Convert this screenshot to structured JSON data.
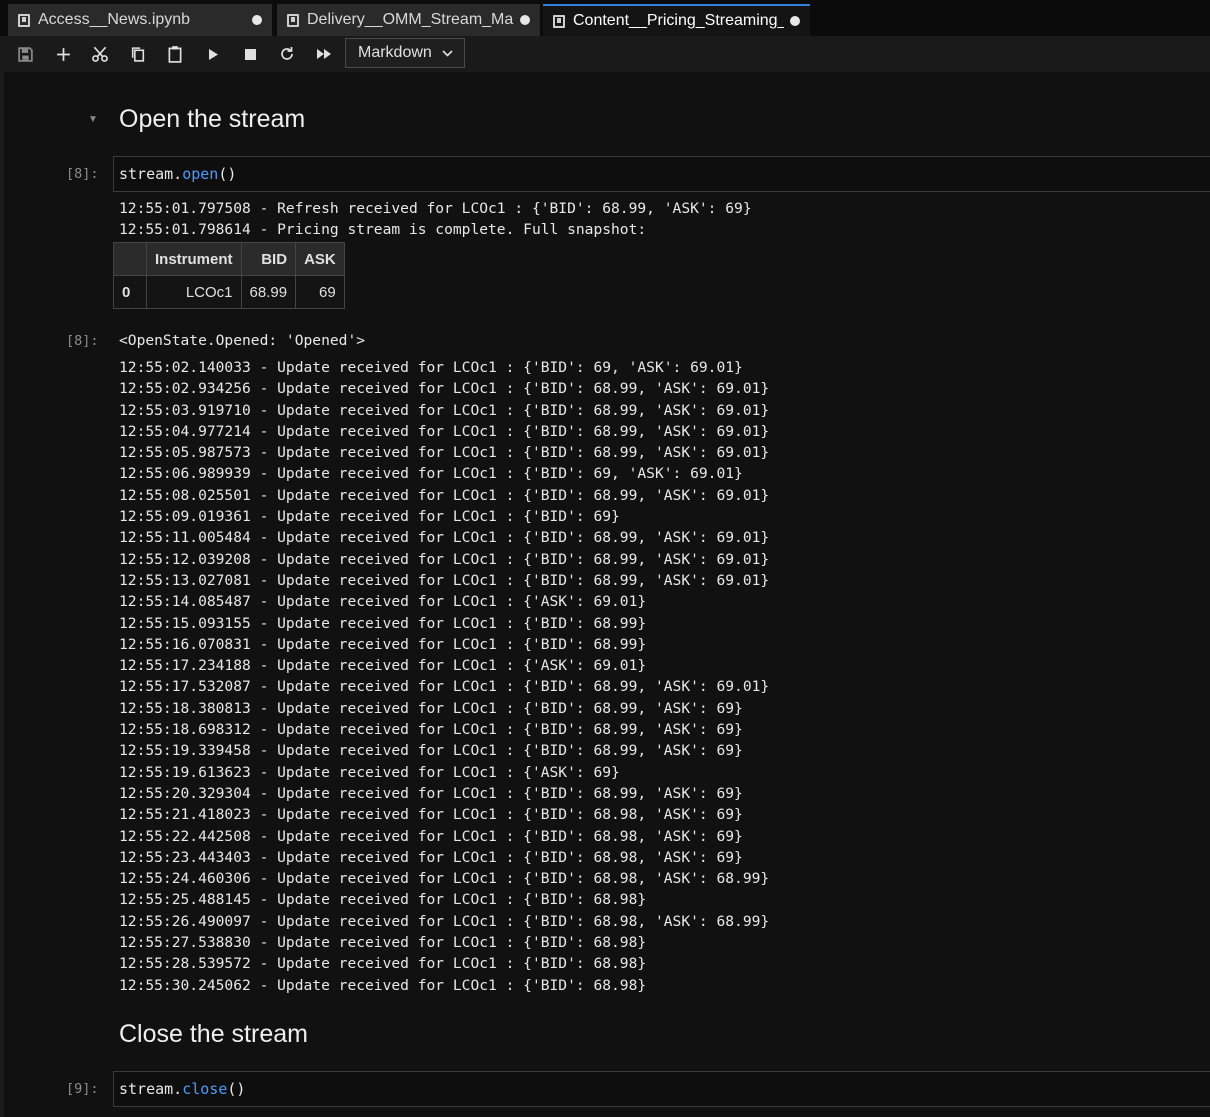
{
  "tabs": [
    {
      "label": "Access__News.ipynb",
      "active": false
    },
    {
      "label": "Delivery__OMM_Stream_Marl",
      "active": false
    },
    {
      "label": "Content__Pricing_Streaming_",
      "active": true
    }
  ],
  "toolbar": {
    "icons": [
      "save-icon",
      "add-cell-icon",
      "cut-icon",
      "copy-icon",
      "paste-icon",
      "run-icon",
      "stop-icon",
      "restart-icon",
      "fast-forward-icon"
    ],
    "cell_type": "Markdown"
  },
  "cells": {
    "heading_open": "Open the stream",
    "prompt_open": "[8]:",
    "code_open_obj": "stream.",
    "code_open_fn": "open",
    "code_open_rest": "()",
    "refresh_line": "12:55:01.797508 - Refresh received for LCOc1 : {'BID': 68.99, 'ASK': 69}",
    "complete_line": "12:55:01.798614 - Pricing stream is complete. Full snapshot:",
    "df": {
      "columns": [
        "",
        "Instrument",
        "BID",
        "ASK"
      ],
      "row_index": "0",
      "row": [
        "LCOc1",
        "68.99",
        "69"
      ]
    },
    "prompt_out": "[8]:",
    "open_state": "<OpenState.Opened: 'Opened'>",
    "updates": [
      "12:55:02.140033 - Update received for LCOc1 : {'BID': 69, 'ASK': 69.01}",
      "12:55:02.934256 - Update received for LCOc1 : {'BID': 68.99, 'ASK': 69.01}",
      "12:55:03.919710 - Update received for LCOc1 : {'BID': 68.99, 'ASK': 69.01}",
      "12:55:04.977214 - Update received for LCOc1 : {'BID': 68.99, 'ASK': 69.01}",
      "12:55:05.987573 - Update received for LCOc1 : {'BID': 68.99, 'ASK': 69.01}",
      "12:55:06.989939 - Update received for LCOc1 : {'BID': 69, 'ASK': 69.01}",
      "12:55:08.025501 - Update received for LCOc1 : {'BID': 68.99, 'ASK': 69.01}",
      "12:55:09.019361 - Update received for LCOc1 : {'BID': 69}",
      "12:55:11.005484 - Update received for LCOc1 : {'BID': 68.99, 'ASK': 69.01}",
      "12:55:12.039208 - Update received for LCOc1 : {'BID': 68.99, 'ASK': 69.01}",
      "12:55:13.027081 - Update received for LCOc1 : {'BID': 68.99, 'ASK': 69.01}",
      "12:55:14.085487 - Update received for LCOc1 : {'ASK': 69.01}",
      "12:55:15.093155 - Update received for LCOc1 : {'BID': 68.99}",
      "12:55:16.070831 - Update received for LCOc1 : {'BID': 68.99}",
      "12:55:17.234188 - Update received for LCOc1 : {'ASK': 69.01}",
      "12:55:17.532087 - Update received for LCOc1 : {'BID': 68.99, 'ASK': 69.01}",
      "12:55:18.380813 - Update received for LCOc1 : {'BID': 68.99, 'ASK': 69}",
      "12:55:18.698312 - Update received for LCOc1 : {'BID': 68.99, 'ASK': 69}",
      "12:55:19.339458 - Update received for LCOc1 : {'BID': 68.99, 'ASK': 69}",
      "12:55:19.613623 - Update received for LCOc1 : {'ASK': 69}",
      "12:55:20.329304 - Update received for LCOc1 : {'BID': 68.99, 'ASK': 69}",
      "12:55:21.418023 - Update received for LCOc1 : {'BID': 68.98, 'ASK': 69}",
      "12:55:22.442508 - Update received for LCOc1 : {'BID': 68.98, 'ASK': 69}",
      "12:55:23.443403 - Update received for LCOc1 : {'BID': 68.98, 'ASK': 69}",
      "12:55:24.460306 - Update received for LCOc1 : {'BID': 68.98, 'ASK': 68.99}",
      "12:55:25.488145 - Update received for LCOc1 : {'BID': 68.98}",
      "12:55:26.490097 - Update received for LCOc1 : {'BID': 68.98, 'ASK': 68.99}",
      "12:55:27.538830 - Update received for LCOc1 : {'BID': 68.98}",
      "12:55:28.539572 - Update received for LCOc1 : {'BID': 68.98}",
      "12:55:30.245062 - Update received for LCOc1 : {'BID': 68.98}"
    ],
    "heading_close": "Close the stream",
    "prompt_close": "[9]:",
    "code_close_obj": "stream.",
    "code_close_fn": "close",
    "code_close_rest": "()"
  }
}
